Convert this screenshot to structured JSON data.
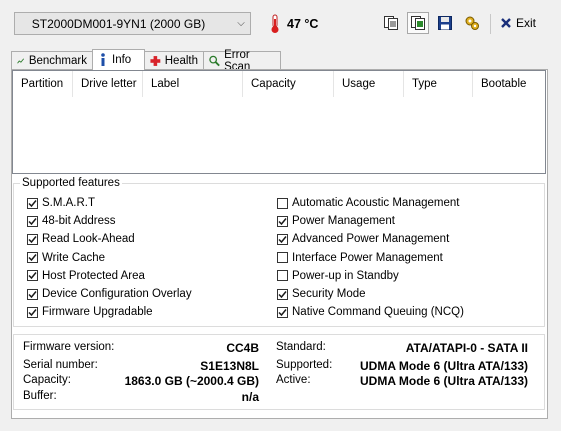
{
  "toolbar": {
    "drive": "ST2000DM001-9YN1 (2000 GB)",
    "temperature": "47 °C",
    "exit_label": "Exit",
    "icons": [
      "copy-text-icon",
      "copy-screenshot-icon",
      "save-icon",
      "options-icon",
      "exit-icon"
    ]
  },
  "tabs": [
    {
      "label": "Benchmark",
      "icon": "benchmark-icon",
      "active": false
    },
    {
      "label": "Info",
      "icon": "info-icon",
      "active": true
    },
    {
      "label": "Health",
      "icon": "health-icon",
      "active": false
    },
    {
      "label": "Error Scan",
      "icon": "error-scan-icon",
      "active": false
    }
  ],
  "partitions": {
    "columns": [
      "Partition",
      "Drive letter",
      "Label",
      "Capacity",
      "Usage",
      "Type",
      "Bootable"
    ],
    "rows": []
  },
  "features": {
    "title": "Supported features",
    "left": [
      {
        "label": "S.M.A.R.T",
        "checked": true
      },
      {
        "label": "48-bit Address",
        "checked": true
      },
      {
        "label": "Read Look-Ahead",
        "checked": true
      },
      {
        "label": "Write Cache",
        "checked": true
      },
      {
        "label": "Host Protected Area",
        "checked": true
      },
      {
        "label": "Device Configuration Overlay",
        "checked": true
      },
      {
        "label": "Firmware Upgradable",
        "checked": true
      }
    ],
    "right": [
      {
        "label": "Automatic Acoustic Management",
        "checked": false
      },
      {
        "label": "Power Management",
        "checked": true
      },
      {
        "label": "Advanced Power Management",
        "checked": true
      },
      {
        "label": "Interface Power Management",
        "checked": false
      },
      {
        "label": "Power-up in Standby",
        "checked": false
      },
      {
        "label": "Security Mode",
        "checked": true
      },
      {
        "label": "Native Command Queuing (NCQ)",
        "checked": true
      }
    ]
  },
  "info": {
    "firmware_label": "Firmware version:",
    "firmware": "CC4B",
    "serial_label": "Serial number:",
    "serial": "S1E13N8L",
    "capacity_label": "Capacity:",
    "capacity": "1863.0 GB (~2000.4 GB)",
    "buffer_label": "Buffer:",
    "buffer": "n/a",
    "standard_label": "Standard:",
    "standard": "ATA/ATAPI-0 - SATA II",
    "supported_label": "Supported:",
    "supported": "UDMA Mode 6 (Ultra ATA/133)",
    "active_label": "Active:",
    "active": "UDMA Mode 6 (Ultra ATA/133)"
  },
  "colors": {
    "health_cross": "#d8232a",
    "info_blue": "#1e4fa8",
    "checkmark": "#1a1a1a"
  }
}
